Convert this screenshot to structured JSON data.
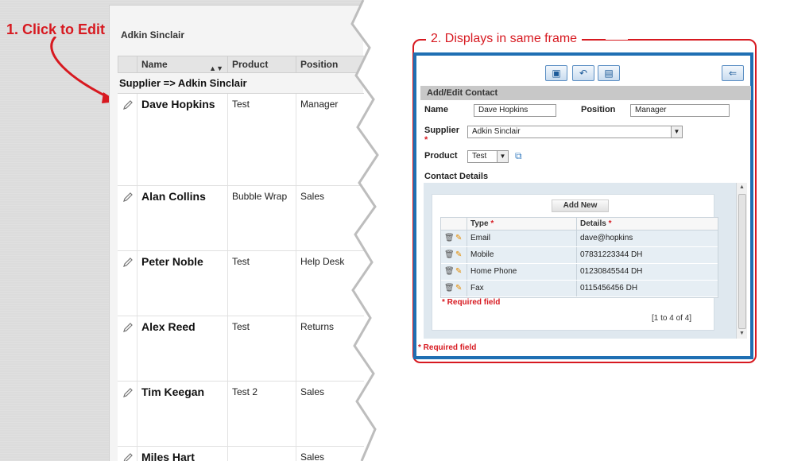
{
  "callouts": {
    "step1": "1. Click to Edit",
    "step2": "2. Displays in same frame"
  },
  "left_grid": {
    "supplier_title": "Adkin Sinclair",
    "columns": [
      "Name",
      "Product",
      "Position"
    ],
    "group_label": "Supplier => Adkin Sinclair",
    "rows": [
      {
        "name": "Dave Hopkins",
        "product": "Test",
        "position": "Manager"
      },
      {
        "name": "Alan Collins",
        "product": "Bubble Wrap",
        "position": "Sales"
      },
      {
        "name": "Peter Noble",
        "product": "Test",
        "position": "Help Desk"
      },
      {
        "name": "Alex Reed",
        "product": "Test",
        "position": "Returns"
      },
      {
        "name": "Tim Keegan",
        "product": "Test 2",
        "position": "Sales"
      },
      {
        "name": "Miles Hart",
        "product": "",
        "position": "Sales"
      }
    ]
  },
  "form": {
    "section_title": "Add/Edit Contact",
    "name_label": "Name",
    "name_value": "Dave Hopkins",
    "position_label": "Position",
    "position_value": "Manager",
    "supplier_label": "Supplier",
    "required_star": "*",
    "supplier_value": "Adkin Sinclair",
    "product_label": "Product",
    "product_value": "Test",
    "contact_details_label": "Contact Details",
    "add_new": "Add New",
    "details_columns": {
      "type": "Type",
      "details": "Details"
    },
    "details_rows": [
      {
        "type": "Email",
        "details": "dave@hopkins"
      },
      {
        "type": "Mobile",
        "details": "07831223344 DH"
      },
      {
        "type": "Home Phone",
        "details": "01230845544 DH"
      },
      {
        "type": "Fax",
        "details": "0115456456 DH"
      }
    ],
    "required_inner": "* Required field",
    "pager": "[1 to 4 of 4]",
    "required_outer": "* Required field"
  },
  "colors": {
    "accent_red": "#d71920",
    "frame_blue": "#1f6fb3"
  },
  "icons": [
    "edit-pencil-icon",
    "save-icon",
    "undo-icon",
    "delete-icon",
    "back-icon",
    "lookup-icon",
    "trash-icon",
    "pencil-icon",
    "sort-icon"
  ]
}
